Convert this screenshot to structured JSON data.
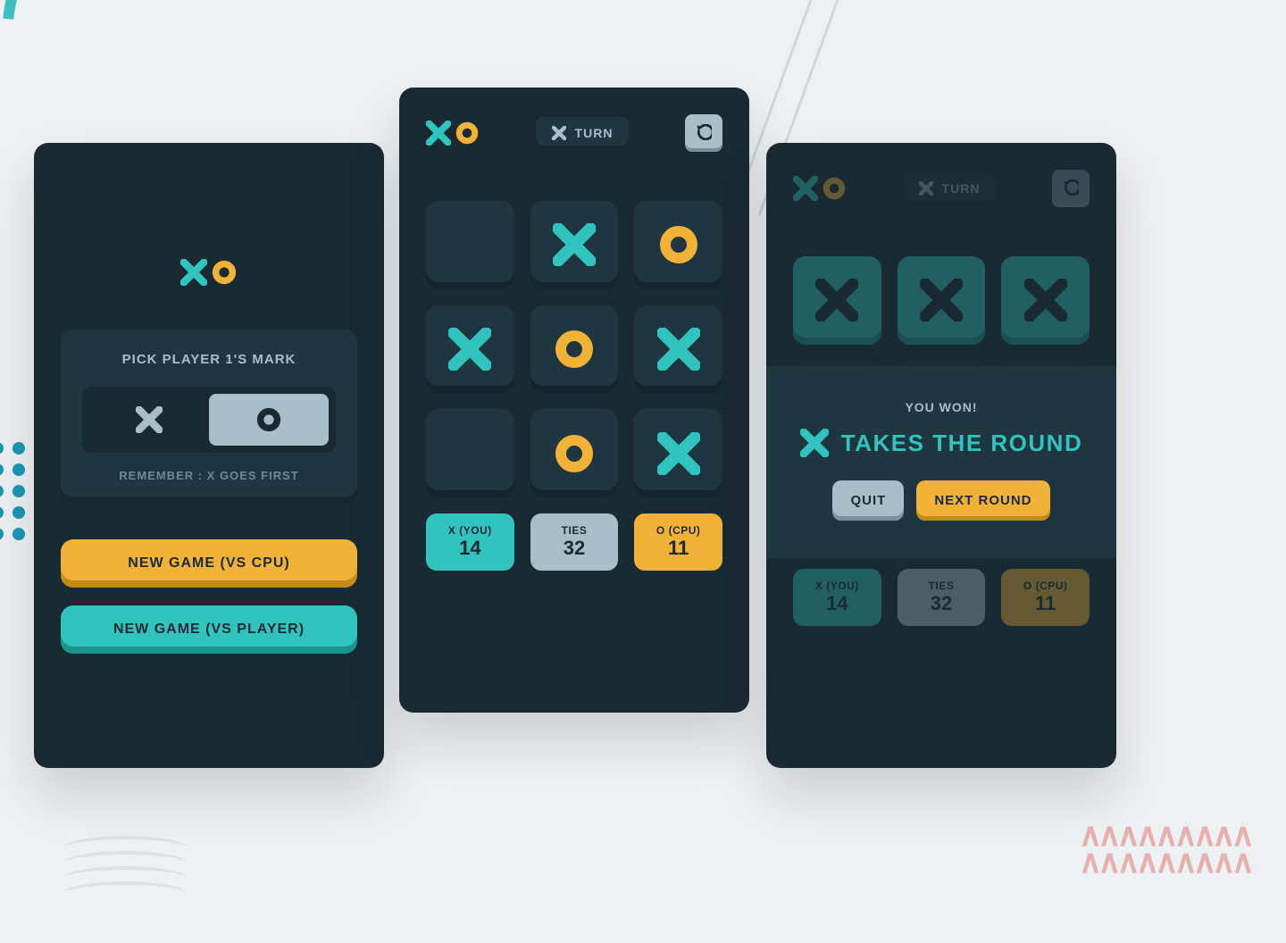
{
  "colors": {
    "teal": "#31c3bd",
    "yellow": "#f2b137",
    "dark": "#1a2a33",
    "panel": "#1f3641",
    "silver": "#a8bfc9"
  },
  "screen1": {
    "pick_title": "PICK PLAYER 1'S MARK",
    "pick_note": "REMEMBER : X GOES FIRST",
    "selected_mark": "O",
    "btn_vs_cpu": "NEW GAME (VS CPU)",
    "btn_vs_player": "NEW GAME  (VS PLAYER)"
  },
  "screen2": {
    "turn_label": "TURN",
    "turn_mark": "X",
    "board": [
      "",
      "X",
      "O",
      "X",
      "O",
      "X",
      "",
      "O",
      "X"
    ],
    "scores": {
      "x_label": "X (YOU)",
      "x_value": "14",
      "tie_label": "TIES",
      "tie_value": "32",
      "o_label": "O (CPU)",
      "o_value": "11"
    }
  },
  "screen3": {
    "turn_label": "TURN",
    "turn_mark": "X",
    "board_top": [
      "X",
      "X",
      "X"
    ],
    "scores": {
      "x_label": "X (YOU)",
      "x_value": "14",
      "tie_label": "TIES",
      "tie_value": "32",
      "o_label": "O (CPU)",
      "o_value": "11"
    },
    "modal": {
      "subtitle": "YOU WON!",
      "winner_mark": "X",
      "title": "TAKES THE ROUND",
      "btn_quit": "QUIT",
      "btn_next": "NEXT ROUND"
    }
  }
}
